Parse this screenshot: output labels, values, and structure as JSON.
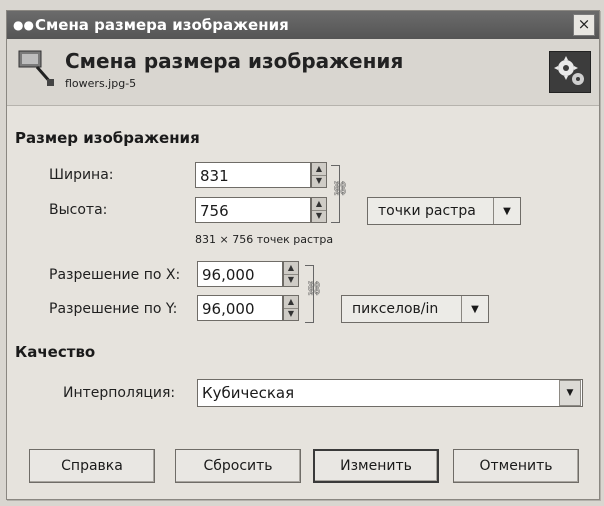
{
  "window": {
    "title": "Смена размера изображения",
    "close_label": "×"
  },
  "header": {
    "title": "Смена размера изображения",
    "subtitle": "flowers.jpg-5"
  },
  "image_size": {
    "section_title": "Размер изображения",
    "width_label": "Ширина:",
    "width_value": "831",
    "height_label": "Высота:",
    "height_value": "756",
    "units_label": "точки растра",
    "pixel_info": "831 × 756 точек растра"
  },
  "resolution": {
    "x_label": "Разрешение по X:",
    "x_value": "96,000",
    "y_label": "Разрешение по Y:",
    "y_value": "96,000",
    "units_label": "пикселов/in"
  },
  "quality": {
    "section_title": "Качество",
    "interpolation_label": "Интерполяция:",
    "interpolation_value": "Кубическая"
  },
  "buttons": {
    "help": "Справка",
    "reset": "Сбросить",
    "resize": "Изменить",
    "cancel": "Отменить"
  },
  "icons": {
    "app": "gimp-eyes-icon",
    "header": "resize-tool-icon",
    "gears": "gears-icon",
    "chain": "chain-link-icon",
    "dropdown": "chevron-down-icon",
    "spin": "spin-arrows-icon"
  }
}
